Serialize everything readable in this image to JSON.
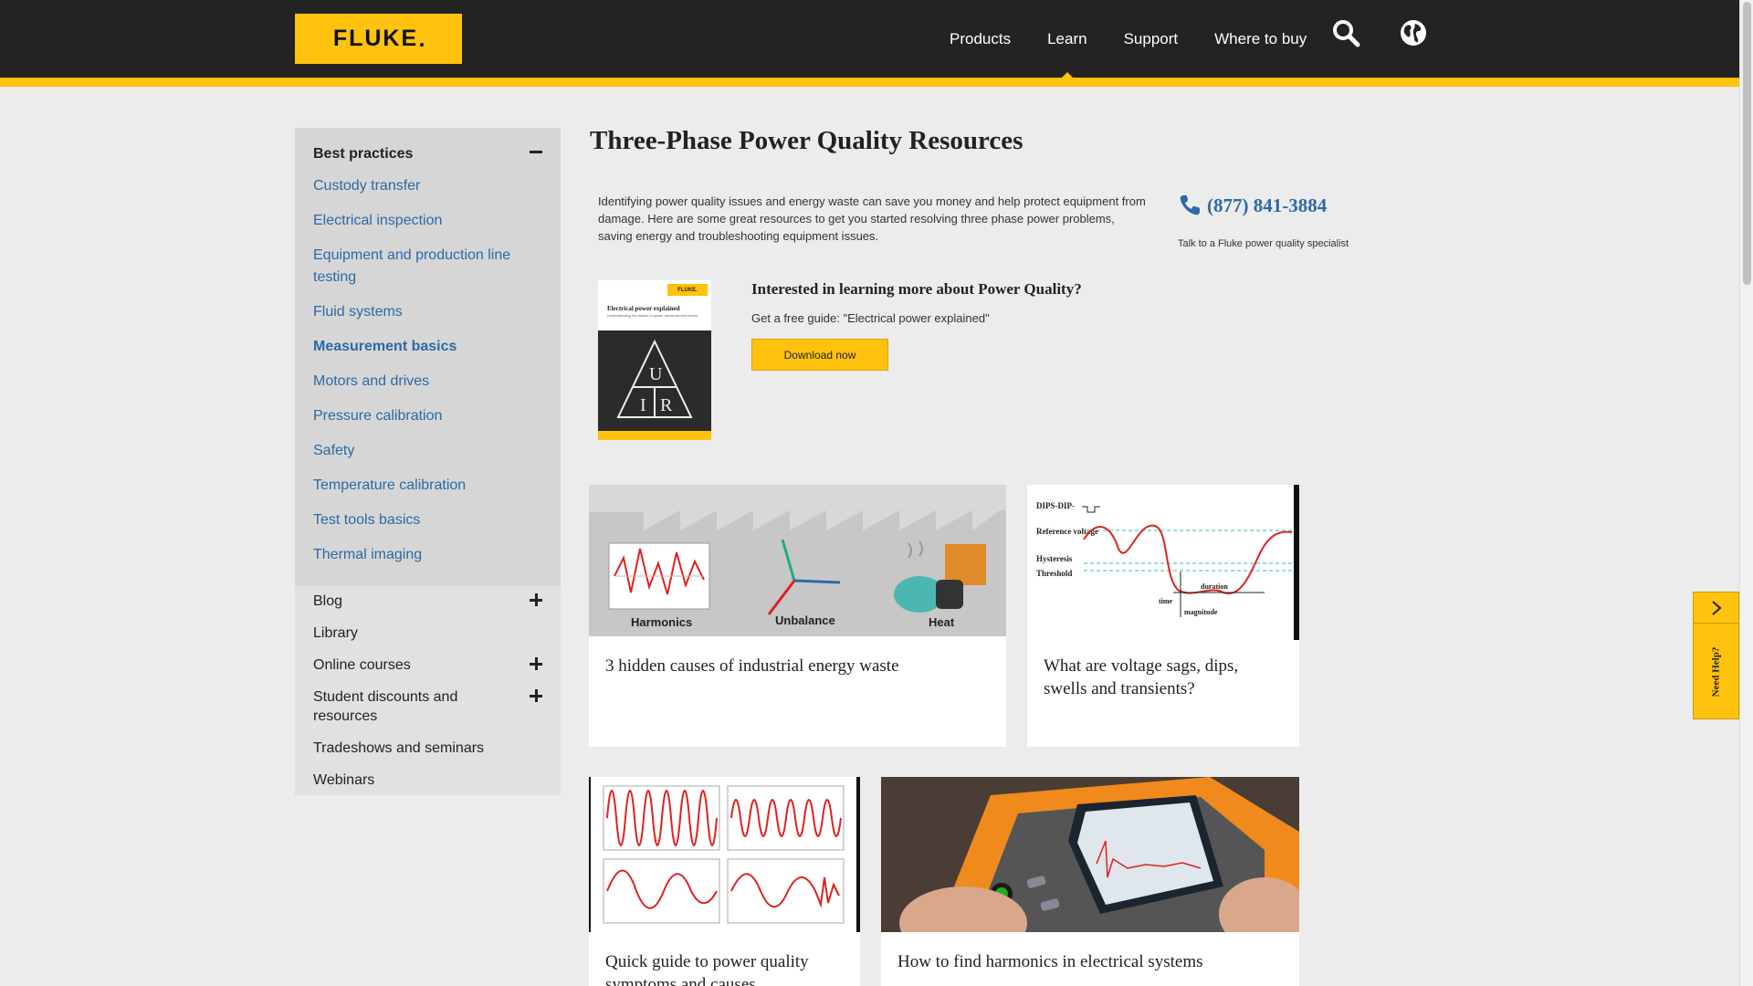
{
  "header": {
    "logo_text": "FLUKE",
    "nav": [
      "Products",
      "Learn",
      "Support",
      "Where to buy"
    ],
    "active_nav": "Learn",
    "accent_color": "#ffc20e"
  },
  "sidebar": {
    "section": {
      "heading": "Best practices",
      "links": [
        "Custody transfer",
        "Electrical inspection",
        "Equipment and production line testing",
        "Fluid systems",
        "Measurement basics",
        "Motors and drives",
        "Pressure calibration",
        "Safety",
        "Temperature calibration",
        "Test tools basics",
        "Thermal imaging"
      ],
      "current": "Measurement basics"
    },
    "items": [
      {
        "label": "Blog",
        "expandable": true
      },
      {
        "label": "Library",
        "expandable": false
      },
      {
        "label": "Online courses",
        "expandable": true
      },
      {
        "label": "Student discounts and resources",
        "expandable": true
      },
      {
        "label": "Tradeshows and seminars",
        "expandable": false
      },
      {
        "label": "Webinars",
        "expandable": false
      }
    ]
  },
  "main": {
    "title": "Three-Phase Power Quality Resources",
    "intro": "Identifying power quality issues and energy waste can save you money and help protect equipment from damage. Here are some great resources to get you started resolving three phase power problems, saving energy and troubleshooting equipment issues.",
    "phone": "(877) 841-3884",
    "phone_caption": "Talk to a Fluke power quality specialist",
    "guide": {
      "cover_logo": "FLUKE.",
      "cover_title": "Electrical power explained",
      "cover_sub": "Understanding the basics of power measurement theory",
      "heading": "Interested in learning more about Power Quality?",
      "text": "Get a free guide: \"Electrical power explained\"",
      "button": "Download now"
    },
    "cards": [
      {
        "title": "3 hidden causes of industrial energy waste",
        "labels": [
          "Harmonics",
          "Unbalance",
          "Heat"
        ]
      },
      {
        "title": "What are voltage sags, dips, swells and transients?",
        "labels": [
          "DIPS-DIP-",
          "Reference voltage",
          "Hysteresis",
          "Threshold",
          "duration",
          "time",
          "magnitude"
        ]
      },
      {
        "title": "Quick guide to power quality symptoms and causes"
      },
      {
        "title": "How to find harmonics in electrical systems"
      }
    ]
  },
  "help_tab": {
    "label": "Need Help?"
  }
}
